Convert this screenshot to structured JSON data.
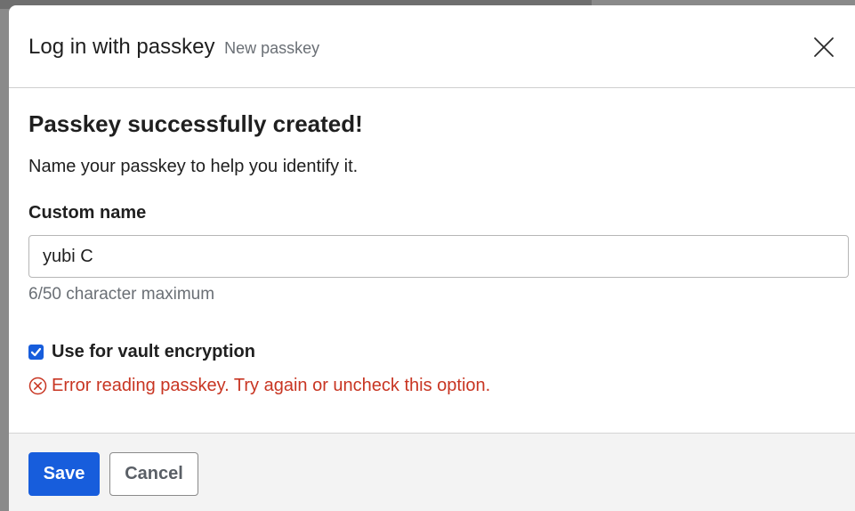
{
  "dialog": {
    "title": "Log in with passkey",
    "subtitle": "New passkey",
    "close_icon": "close-icon"
  },
  "body": {
    "heading": "Passkey successfully created!",
    "help_text": "Name your passkey to help you identify it.",
    "custom_name": {
      "label": "Custom name",
      "value": "yubi C",
      "hint": "6/50 character maximum"
    },
    "vault_encryption": {
      "label": "Use for vault encryption",
      "checked": true
    },
    "error": {
      "icon": "error-circle-icon",
      "text": "Error reading passkey. Try again or uncheck this option."
    }
  },
  "footer": {
    "save_label": "Save",
    "cancel_label": "Cancel"
  },
  "colors": {
    "primary": "#175ddc",
    "error": "#c83522",
    "muted_text": "#6a6f75",
    "text": "#1f1f1f",
    "footer_bg": "#f3f3f3"
  }
}
